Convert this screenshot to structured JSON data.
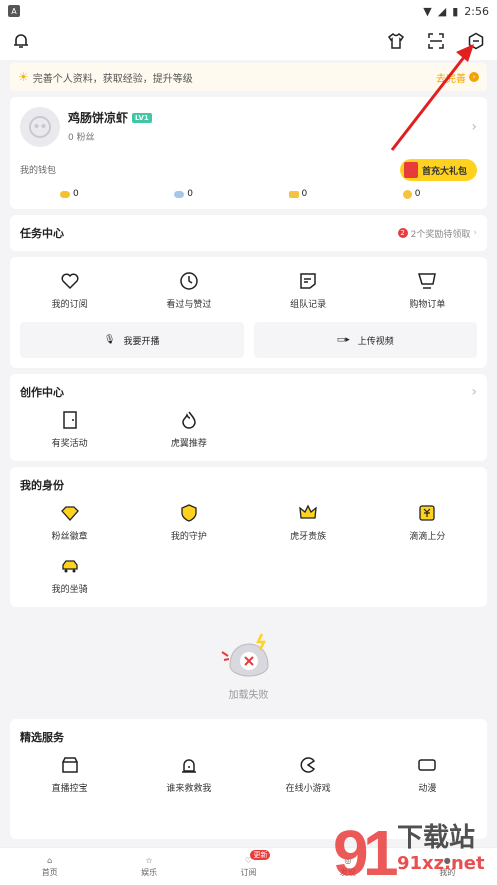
{
  "status": {
    "left_icon": "A",
    "time": "2:56"
  },
  "banner": {
    "text": "完善个人资料，获取经验，提升等级",
    "action": "去完善"
  },
  "profile": {
    "name": "鸡肠饼凉虾",
    "level": "LV1",
    "fans": "0 粉丝",
    "wallet_label": "我的钱包",
    "gift_label": "首充大礼包",
    "coins": [
      {
        "value": "0",
        "color": "#f1c232"
      },
      {
        "value": "0",
        "color": "#a5c8e8"
      },
      {
        "value": "0",
        "color": "#f5c242"
      },
      {
        "value": "0",
        "color": "#f5c242"
      }
    ]
  },
  "task": {
    "title": "任务中心",
    "badge": "2",
    "note": "2个奖励待领取"
  },
  "quick": {
    "items": [
      "我的订阅",
      "看过与赞过",
      "组队记录",
      "购物订单"
    ],
    "live_btn": "我要开播",
    "upload_btn": "上传视频"
  },
  "create": {
    "title": "创作中心",
    "items": [
      "有奖活动",
      "虎翼推荐"
    ]
  },
  "identity": {
    "title": "我的身份",
    "items": [
      "粉丝徽章",
      "我的守护",
      "虎牙贵族",
      "滴滴上分",
      "我的坐骑"
    ]
  },
  "load_fail": "加载失败",
  "service": {
    "title": "精选服务",
    "items": [
      "直播控宝",
      "谁来救救我",
      "在线小游戏",
      "动漫"
    ]
  },
  "tabs": [
    {
      "label": "首页"
    },
    {
      "label": "娱乐"
    },
    {
      "label": "订阅",
      "badge": "更新"
    },
    {
      "label": "发现"
    },
    {
      "label": "我的"
    }
  ],
  "watermark": {
    "brand": "下载站",
    "url": "91xz.net"
  },
  "colors": {
    "accent": "#ffd21f",
    "badge": "#e83c3c",
    "arrow": "#e21f1f"
  }
}
